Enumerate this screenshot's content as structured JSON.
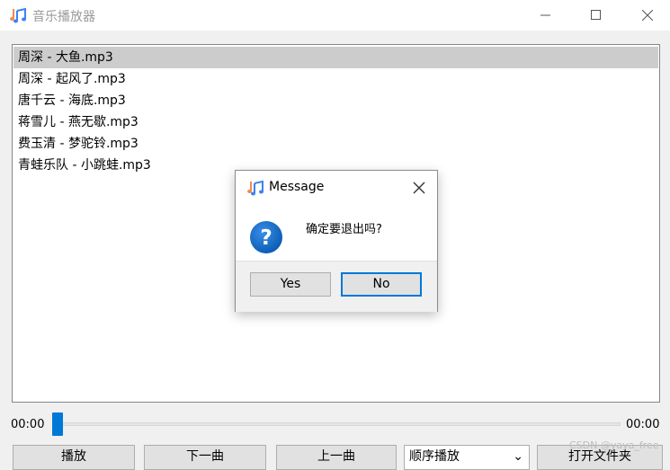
{
  "window": {
    "title": "音乐播放器",
    "icon": "music-note-icon"
  },
  "playlist": {
    "selected_index": 0,
    "items": [
      "周深 - 大鱼.mp3",
      "周深 - 起风了.mp3",
      "唐千云 - 海底.mp3",
      "蒋雪儿 - 燕无歇.mp3",
      "费玉清 - 梦驼铃.mp3",
      "青蛙乐队 - 小跳蛙.mp3"
    ]
  },
  "progress": {
    "current_time": "00:00",
    "total_time": "00:00",
    "fraction": 0
  },
  "controls": {
    "play_label": "播放",
    "next_label": "下一曲",
    "prev_label": "上一曲",
    "mode_value": "顺序播放",
    "open_label": "打开文件夹"
  },
  "dialog": {
    "title": "Message",
    "message": "确定要退出吗?",
    "yes_label": "Yes",
    "no_label": "No",
    "icon": "question-icon"
  },
  "watermark": "CSDN @yaya_free",
  "colors": {
    "accent": "#0078d7",
    "selection": "#cccccc",
    "background": "#f0f0f0"
  }
}
